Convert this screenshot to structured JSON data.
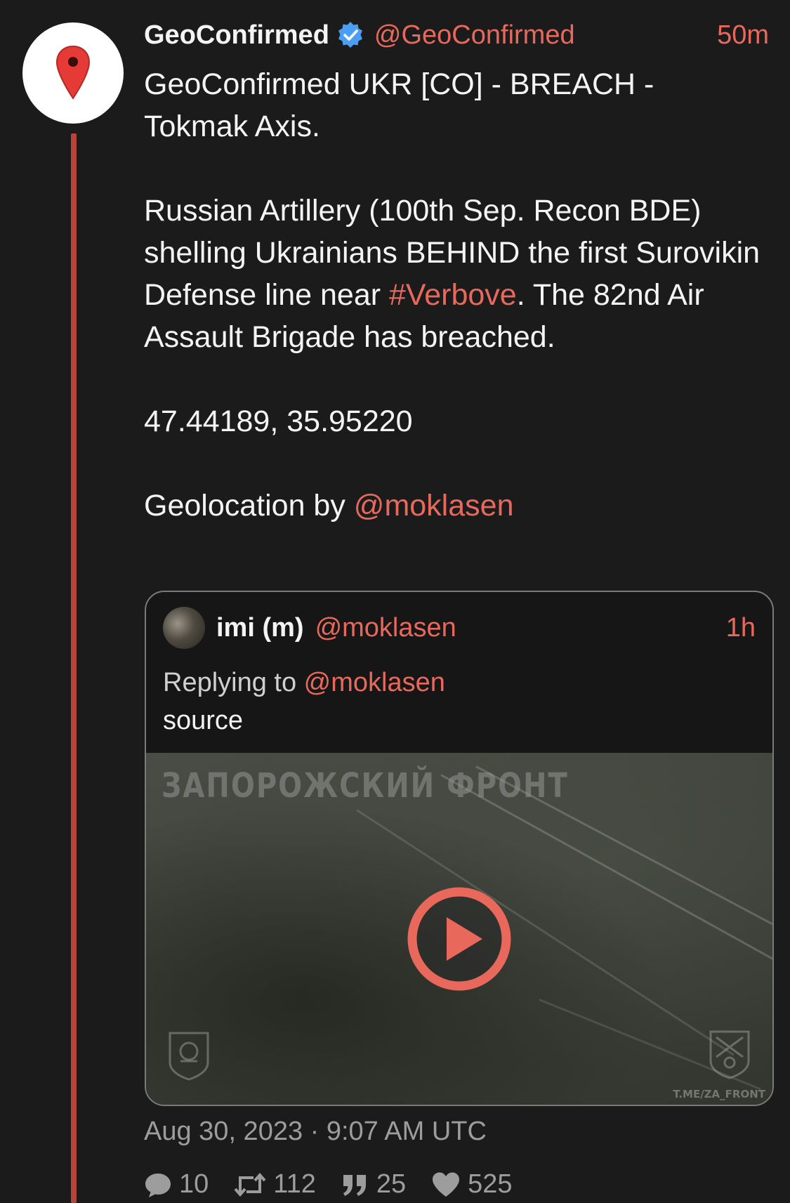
{
  "tweet": {
    "display_name": "GeoConfirmed",
    "handle": "@GeoConfirmed",
    "time": "50m",
    "line1": "GeoConfirmed UKR [CO] - BREACH -",
    "line2": "Tokmak Axis.",
    "para2_before": "Russian Artillery (100th Sep. Recon BDE) shelling Ukrainians BEHIND the first Surovikin Defense line near ",
    "hashtag": "#Verbove",
    "para2_after": ". The 82nd Air Assault Brigade has breached.",
    "coordinates": "47.44189, 35.95220",
    "geolocation_prefix": "Geolocation by ",
    "geolocation_mention": "@moklasen",
    "date": "Aug 30, 2023 · 9:07 AM UTC"
  },
  "quote": {
    "display_name": "imi (m)",
    "handle": "@moklasen",
    "time": "1h",
    "replying_prefix": "Replying to ",
    "replying_handle": "@moklasen",
    "text": "source",
    "media": {
      "watermark": "ЗАПОРОЖСКИЙ ФРОНТ",
      "site": "T.ME/ZA_FRONT"
    }
  },
  "stats": {
    "replies": "10",
    "retweets": "112",
    "quotes": "25",
    "likes": "525"
  },
  "colors": {
    "accent": "#e8695c",
    "verified": "#4a9ff5",
    "thread_line": "#b5443a",
    "background": "#1b1b1b"
  },
  "icons": {
    "avatar": "map-pin-icon",
    "verified": "verified-badge-icon",
    "play": "play-icon",
    "replies": "comment-icon",
    "retweets": "retweet-icon",
    "quotes": "quote-icon",
    "likes": "heart-icon"
  }
}
